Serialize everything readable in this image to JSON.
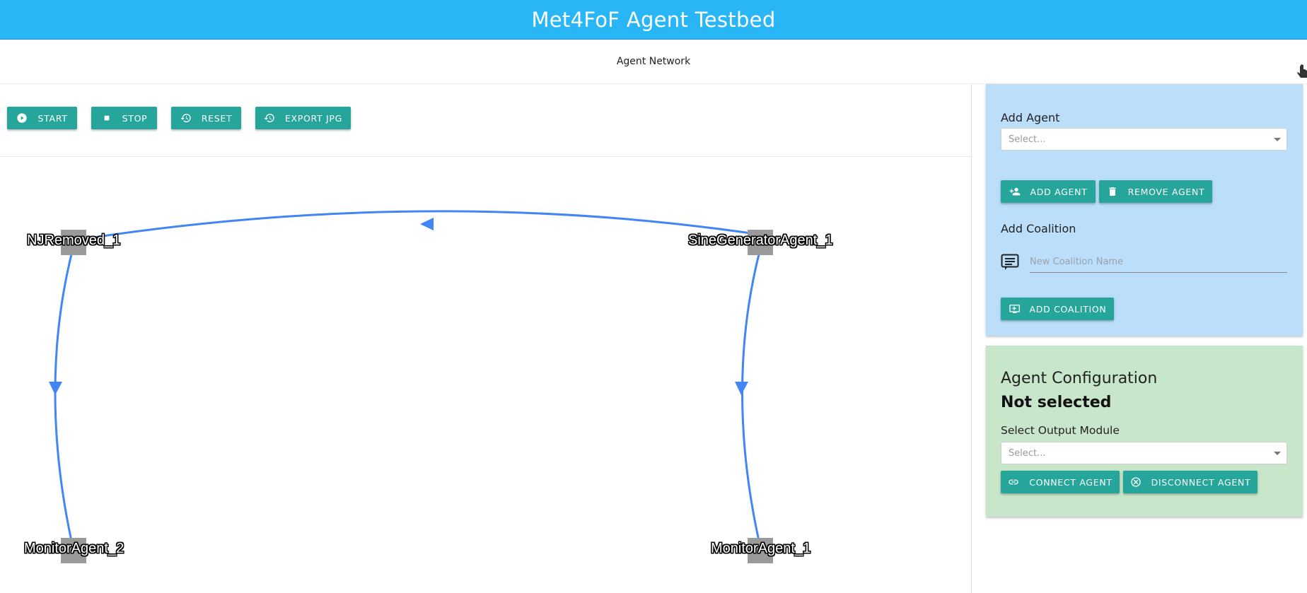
{
  "app": {
    "title": "Met4FoF Agent Testbed"
  },
  "section": {
    "title": "Agent Network"
  },
  "toolbar": {
    "start_label": "START",
    "stop_label": "STOP",
    "reset_label": "RESET",
    "export_label": "EXPORT JPG"
  },
  "graph": {
    "nodes": {
      "njremoved": "NJRemoved_1",
      "sine": "SineGeneratorAgent_1",
      "monitor2": "MonitorAgent_2",
      "monitor1": "MonitorAgent_1"
    },
    "edge_color": "#4285f4",
    "node_color": "#9a9a9a"
  },
  "add_agent": {
    "label": "Add Agent",
    "select_placeholder": "Select...",
    "add_button": "ADD AGENT",
    "remove_button": "REMOVE AGENT"
  },
  "add_coalition": {
    "label": "Add Coalition",
    "input_placeholder": "New Coalition Name",
    "button": "ADD COALITION"
  },
  "agent_config": {
    "title": "Agent Configuration",
    "status": "Not selected",
    "output_label": "Select Output Module",
    "select_placeholder": "Select...",
    "connect_button": "CONNECT AGENT",
    "disconnect_button": "DISCONNECT AGENT"
  },
  "colors": {
    "header": "#29b6f6",
    "button": "#26a69a",
    "panel_blue": "#bbdefb",
    "panel_green": "#c8e6c9"
  }
}
